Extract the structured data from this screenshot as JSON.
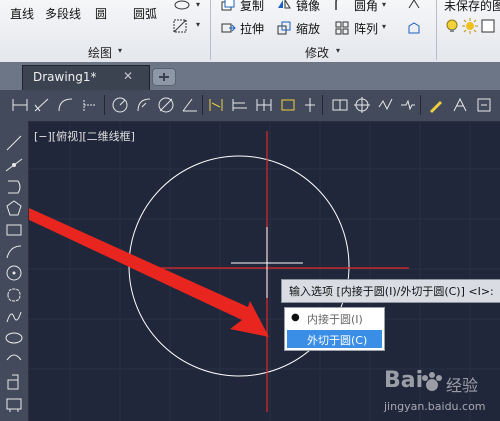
{
  "ribbon": {
    "draw_panel": {
      "line": "直线",
      "polyline": "多段线",
      "circle": "圆",
      "arc": "圆弧",
      "caption": "绘图"
    },
    "modify_panel": {
      "copy": "复制",
      "mirror": "镜像",
      "fillet": "圆角",
      "stretch": "拉伸",
      "scale": "缩放",
      "array": "阵列",
      "caption": "修改"
    },
    "layer_panel": {
      "layer_state": "未保存的图"
    },
    "dropdown_glyph": "▾"
  },
  "tabs": [
    {
      "label": "Drawing1*",
      "close": "✕"
    }
  ],
  "viewport": {
    "label": "[−][俯视][二维线框]"
  },
  "command": {
    "prompt": "输入选项 [内接于圆(I)/外切于圆(C)] <I>:",
    "options": [
      {
        "label": "内接于圆(I)",
        "selected": false,
        "bullet": "●"
      },
      {
        "label": "外切于圆(C)",
        "selected": true
      }
    ]
  },
  "watermark": {
    "brand": "Bai",
    "brand_cn": "经验",
    "url": "jingyan.baidu.com"
  },
  "colors": {
    "canvas": "#21273a",
    "crosshair": "#e0282a",
    "arrow": "#e8261f",
    "circle": "#ffffff",
    "highlight": "#3a8ee6"
  }
}
